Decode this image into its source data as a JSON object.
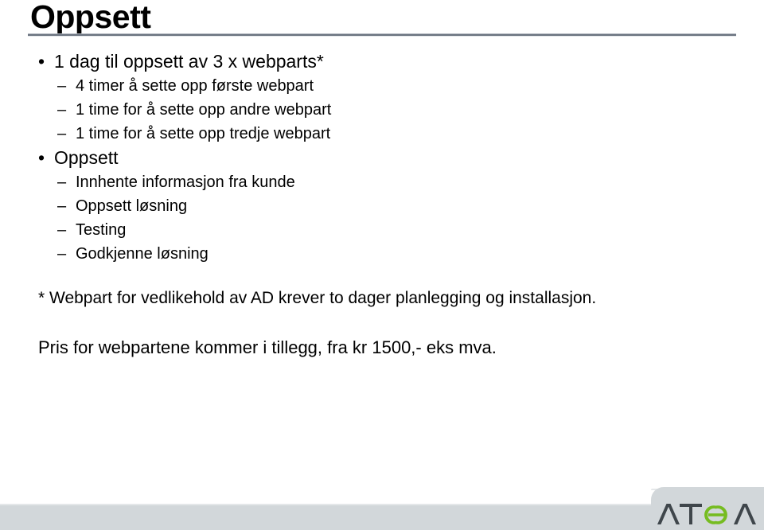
{
  "slide": {
    "title": "Oppsett",
    "bullets": [
      {
        "level": 1,
        "marker": "•",
        "text": "1 dag til oppsett av 3 x webparts*"
      },
      {
        "level": 2,
        "marker": "–",
        "text": "4 timer å sette opp første webpart"
      },
      {
        "level": 2,
        "marker": "–",
        "text": "1 time for å sette opp andre webpart"
      },
      {
        "level": 2,
        "marker": "–",
        "text": "1 time for å sette opp tredje webpart"
      },
      {
        "level": 1,
        "marker": "•",
        "text": "Oppsett"
      },
      {
        "level": 2,
        "marker": "–",
        "text": "Innhente informasjon fra kunde"
      },
      {
        "level": 2,
        "marker": "–",
        "text": "Oppsett løsning"
      },
      {
        "level": 2,
        "marker": "–",
        "text": "Testing"
      },
      {
        "level": 2,
        "marker": "–",
        "text": "Godkjenne løsning"
      }
    ],
    "footnote": "* Webpart for vedlikehold av AD krever to dager planlegging og installasjon.",
    "price_note": "Pris for webpartene kommer i tillegg, fra kr 1500,- eks mva.",
    "logo_text": "ATEA",
    "colors": {
      "rule": "#6b7480",
      "band": "#d2d7da",
      "logo_dark": "#3f464b",
      "logo_green": "#76bc21",
      "text": "#000000"
    }
  }
}
